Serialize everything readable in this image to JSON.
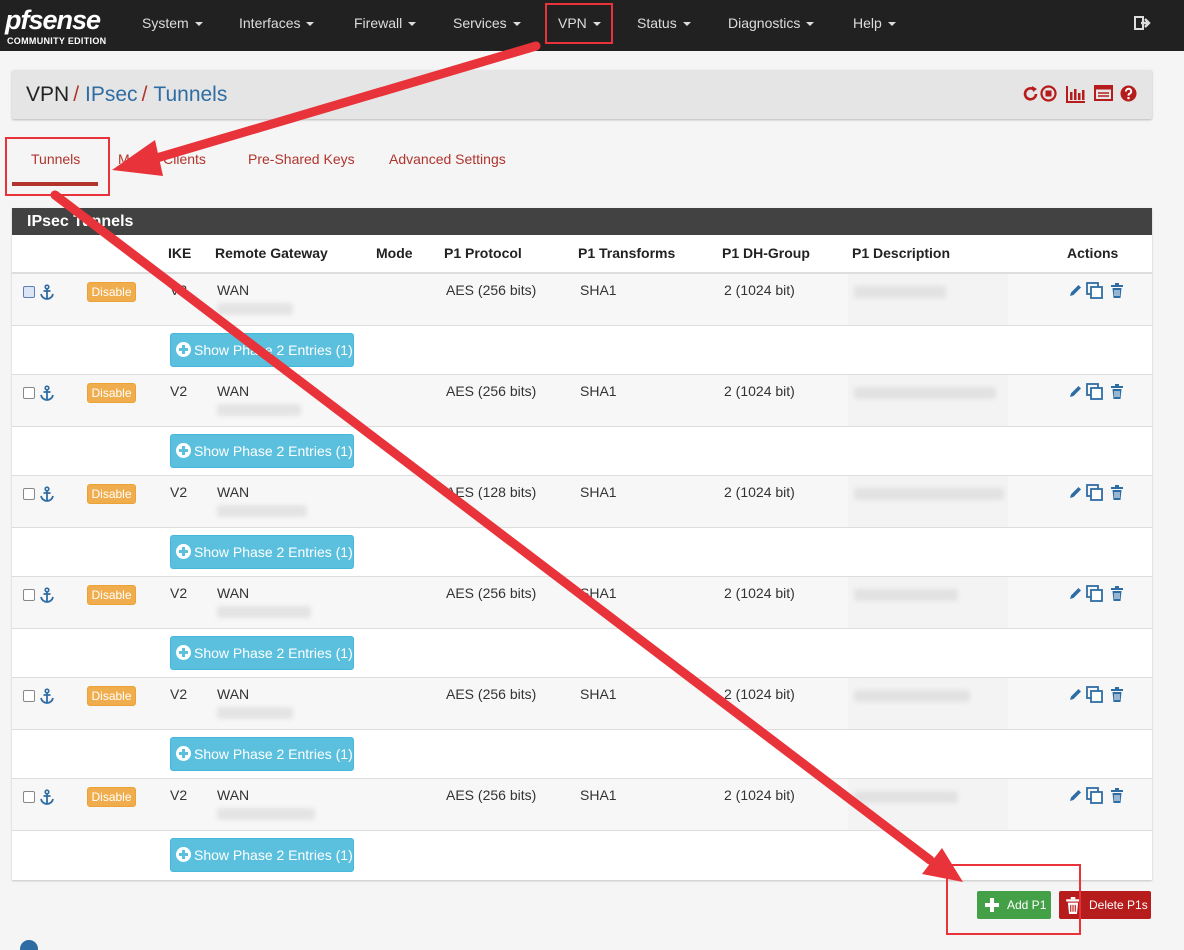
{
  "brand": {
    "logo_text": "pfsense",
    "edition": "COMMUNITY EDITION"
  },
  "nav": {
    "items": [
      {
        "label": "System"
      },
      {
        "label": "Interfaces"
      },
      {
        "label": "Firewall"
      },
      {
        "label": "Services"
      },
      {
        "label": "VPN"
      },
      {
        "label": "Status"
      },
      {
        "label": "Diagnostics"
      },
      {
        "label": "Help"
      }
    ],
    "logout_icon": "sign-out-icon"
  },
  "breadcrumb": {
    "root": "VPN",
    "sep1": "/",
    "level2": "IPsec",
    "sep2": "/",
    "level3": "Tunnels"
  },
  "header_icons": [
    "restart-service-icon",
    "stop-service-icon",
    "status-chart-icon",
    "log-icon",
    "help-icon"
  ],
  "tabs": [
    {
      "label": "Tunnels",
      "active": true
    },
    {
      "label": "Mobile Clients"
    },
    {
      "label": "Pre-Shared Keys"
    },
    {
      "label": "Advanced Settings"
    }
  ],
  "panel": {
    "title": "IPsec Tunnels",
    "columns": [
      "IKE",
      "Remote Gateway",
      "Mode",
      "P1 Protocol",
      "P1 Transforms",
      "P1 DH-Group",
      "P1 Description",
      "Actions"
    ]
  },
  "tunnels": [
    {
      "disable_label": "Disable",
      "ike": "V2",
      "gateway": "WAN",
      "protocol": "AES (256 bits)",
      "transforms": "SHA1",
      "dh_group": "2 (1024 bit)",
      "show_p2_label": "Show Phase 2 Entries (1)"
    },
    {
      "disable_label": "Disable",
      "ike": "V2",
      "gateway": "WAN",
      "protocol": "AES (256 bits)",
      "transforms": "SHA1",
      "dh_group": "2 (1024 bit)",
      "show_p2_label": "Show Phase 2 Entries (1)"
    },
    {
      "disable_label": "Disable",
      "ike": "V2",
      "gateway": "WAN",
      "protocol": "AES (128 bits)",
      "transforms": "SHA1",
      "dh_group": "2 (1024 bit)",
      "show_p2_label": "Show Phase 2 Entries (1)"
    },
    {
      "disable_label": "Disable",
      "ike": "V2",
      "gateway": "WAN",
      "protocol": "AES (256 bits)",
      "transforms": "SHA1",
      "dh_group": "2 (1024 bit)",
      "show_p2_label": "Show Phase 2 Entries (1)"
    },
    {
      "disable_label": "Disable",
      "ike": "V2",
      "gateway": "WAN",
      "protocol": "AES (256 bits)",
      "transforms": "SHA1",
      "dh_group": "2 (1024 bit)",
      "show_p2_label": "Show Phase 2 Entries (1)"
    },
    {
      "disable_label": "Disable",
      "ike": "V2",
      "gateway": "WAN",
      "protocol": "AES (256 bits)",
      "transforms": "SHA1",
      "dh_group": "2 (1024 bit)",
      "show_p2_label": "Show Phase 2 Entries (1)"
    }
  ],
  "footer": {
    "add_label": "Add P1",
    "delete_label": "Delete P1s"
  },
  "colors": {
    "navbar": "#212121",
    "accent_red": "#b0342c",
    "link_blue": "#2e6da4",
    "warning": "#f0ad4e",
    "info": "#5bc0de",
    "success": "#43a047",
    "danger": "#b71c1c",
    "annotation": "#e8333a"
  }
}
